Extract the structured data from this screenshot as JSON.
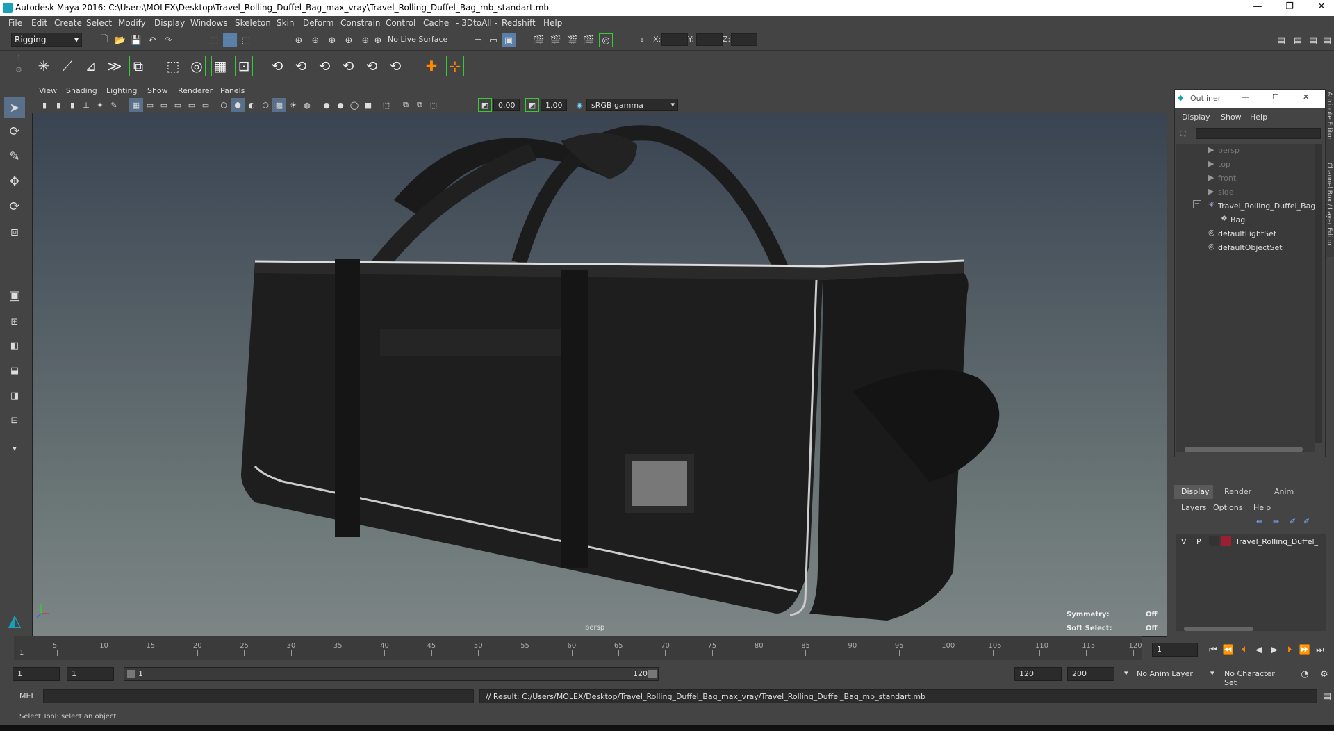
{
  "window": {
    "title": "Autodesk Maya 2016: C:\\Users\\MOLEX\\Desktop\\Travel_Rolling_Duffel_Bag_max_vray\\Travel_Rolling_Duffel_Bag_mb_standart.mb",
    "minimize": "—",
    "restore": "❐",
    "close": "✕"
  },
  "menubar": [
    "File",
    "Edit",
    "Create",
    "Select",
    "Modify",
    "Display",
    "Windows",
    "Skeleton",
    "Skin",
    "Deform",
    "Constrain",
    "Control",
    "Cache",
    "- 3DtoAll -",
    "Redshift",
    "Help"
  ],
  "status_line": {
    "mode": "Rigging",
    "live_surface": "No Live Surface",
    "x_label": "X:",
    "y_label": "Y:",
    "z_label": "Z:"
  },
  "viewport": {
    "menu": [
      "View",
      "Shading",
      "Lighting",
      "Show",
      "Renderer",
      "Panels"
    ],
    "exposure": "0.00",
    "gamma": "1.00",
    "color_space": "sRGB gamma",
    "camera_label": "persp",
    "symmetry_label": "Symmetry:",
    "symmetry_value": "Off",
    "soft_select_label": "Soft Select:",
    "soft_select_value": "Off"
  },
  "outliner": {
    "title": "Outliner",
    "menu": [
      "Display",
      "Show",
      "Help"
    ],
    "items": [
      {
        "label": "persp",
        "icon": "camera-icon",
        "dim": true
      },
      {
        "label": "top",
        "icon": "camera-icon",
        "dim": true
      },
      {
        "label": "front",
        "icon": "camera-icon",
        "dim": true
      },
      {
        "label": "side",
        "icon": "camera-icon",
        "dim": true
      },
      {
        "label": "Travel_Rolling_Duffel_Bag",
        "icon": "group-icon",
        "dim": false
      },
      {
        "label": "Bag",
        "icon": "mesh-icon",
        "dim": false
      },
      {
        "label": "defaultLightSet",
        "icon": "set-icon",
        "dim": false
      },
      {
        "label": "defaultObjectSet",
        "icon": "set-icon",
        "dim": false
      }
    ]
  },
  "side_tabs": {
    "attribute_editor": "Attribute Editor",
    "channel_box": "Channel Box / Layer Editor"
  },
  "layer_editor": {
    "tabs": [
      "Display",
      "Render",
      "Anim"
    ],
    "menu": [
      "Layers",
      "Options",
      "Help"
    ],
    "layer": {
      "v": "V",
      "p": "P",
      "name": "Travel_Rolling_Duffel_"
    }
  },
  "timeline": {
    "ticks": [
      5,
      10,
      15,
      20,
      25,
      30,
      35,
      40,
      45,
      50,
      55,
      60,
      65,
      70,
      75,
      80,
      85,
      90,
      95,
      100,
      105,
      110,
      115,
      120
    ],
    "start_marker": "1",
    "current_frame": "1"
  },
  "range": {
    "start": "1",
    "start2": "1",
    "slider_start": "1",
    "slider_end": "120",
    "end": "120",
    "end2": "200",
    "anim_layer": "No Anim Layer",
    "char_set": "No Character Set"
  },
  "command_line": {
    "label": "MEL",
    "result": "// Result: C:/Users/MOLEX/Desktop/Travel_Rolling_Duffel_Bag_max_vray/Travel_Rolling_Duffel_Bag_mb_standart.mb"
  },
  "help_line": "Select Tool: select an object"
}
